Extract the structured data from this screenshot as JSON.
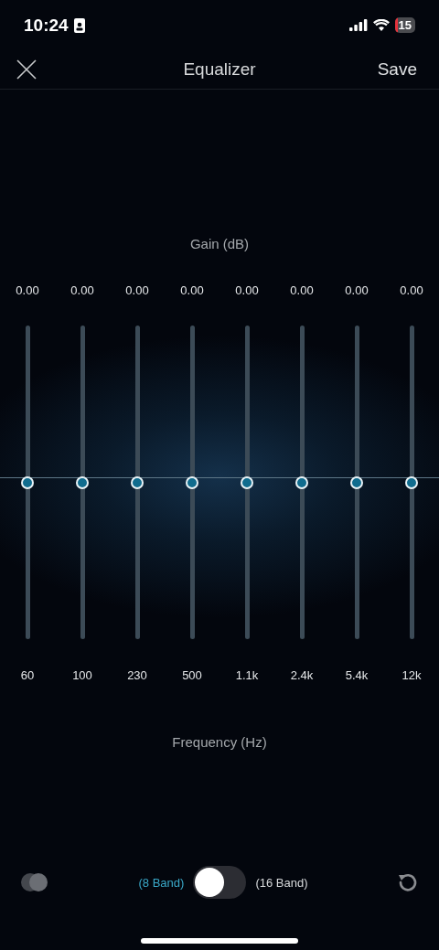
{
  "status_bar": {
    "time": "10:24",
    "battery": "15"
  },
  "nav": {
    "title": "Equalizer",
    "action": "Save"
  },
  "gain_label": "Gain (dB)",
  "bands": [
    {
      "gain": "0.00",
      "frequency": "60",
      "level": 0.5
    },
    {
      "gain": "0.00",
      "frequency": "100",
      "level": 0.5
    },
    {
      "gain": "0.00",
      "frequency": "230",
      "level": 0.5
    },
    {
      "gain": "0.00",
      "frequency": "500",
      "level": 0.5
    },
    {
      "gain": "0.00",
      "frequency": "1.1k",
      "level": 0.5
    },
    {
      "gain": "0.00",
      "frequency": "2.4k",
      "level": 0.5
    },
    {
      "gain": "0.00",
      "frequency": "5.4k",
      "level": 0.5
    },
    {
      "gain": "0.00",
      "frequency": "12k",
      "level": 0.5
    }
  ],
  "frequency_label": "Frequency (Hz)",
  "band_toggle": {
    "on": false,
    "left_label": "(8 Band)",
    "right_label": "(16 Band)"
  }
}
